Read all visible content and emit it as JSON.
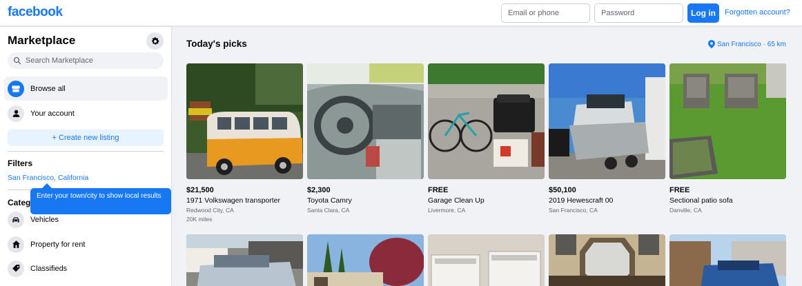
{
  "topbar": {
    "logo": "facebook",
    "email_placeholder": "Email or phone",
    "password_placeholder": "Password",
    "login_label": "Log in",
    "forgot_label": "Forgotten account?"
  },
  "sidebar": {
    "title": "Marketplace",
    "search_placeholder": "Search Marketplace",
    "items": [
      {
        "label": "Browse all",
        "icon": "storefront-icon"
      },
      {
        "label": "Your account",
        "icon": "user-icon"
      }
    ],
    "create_label": "+ Create new listing",
    "filters_heading": "Filters",
    "location_link": "San Francisco, California",
    "categories_heading": "Categ",
    "tooltip": "Enter your town/city to show local results",
    "categories": [
      {
        "label": "Vehicles",
        "icon": "car-icon"
      },
      {
        "label": "Property for rent",
        "icon": "house-icon"
      },
      {
        "label": "Classifieds",
        "icon": "tag-icon"
      }
    ]
  },
  "main": {
    "heading": "Today's picks",
    "location": "San Francisco · 65 km",
    "listings": [
      {
        "price": "$21,500",
        "title": "1971 Volkswagen transporter",
        "location": "Redwood City, CA",
        "extra": "20K miles"
      },
      {
        "price": "$2,300",
        "title": "Toyota Camry",
        "location": "Santa Clara, CA",
        "extra": ""
      },
      {
        "price": "FREE",
        "title": "Garage Clean Up",
        "location": "Livermore, CA",
        "extra": ""
      },
      {
        "price": "$50,100",
        "title": "2019 Hewescraft 00",
        "location": "San Francisco, CA",
        "extra": ""
      },
      {
        "price": "FREE",
        "title": "Sectional patio sofa",
        "location": "Danville, CA",
        "extra": ""
      }
    ]
  },
  "colors": {
    "brand": "#1877f2",
    "bg": "#f0f2f5",
    "text_secondary": "#65676b"
  }
}
